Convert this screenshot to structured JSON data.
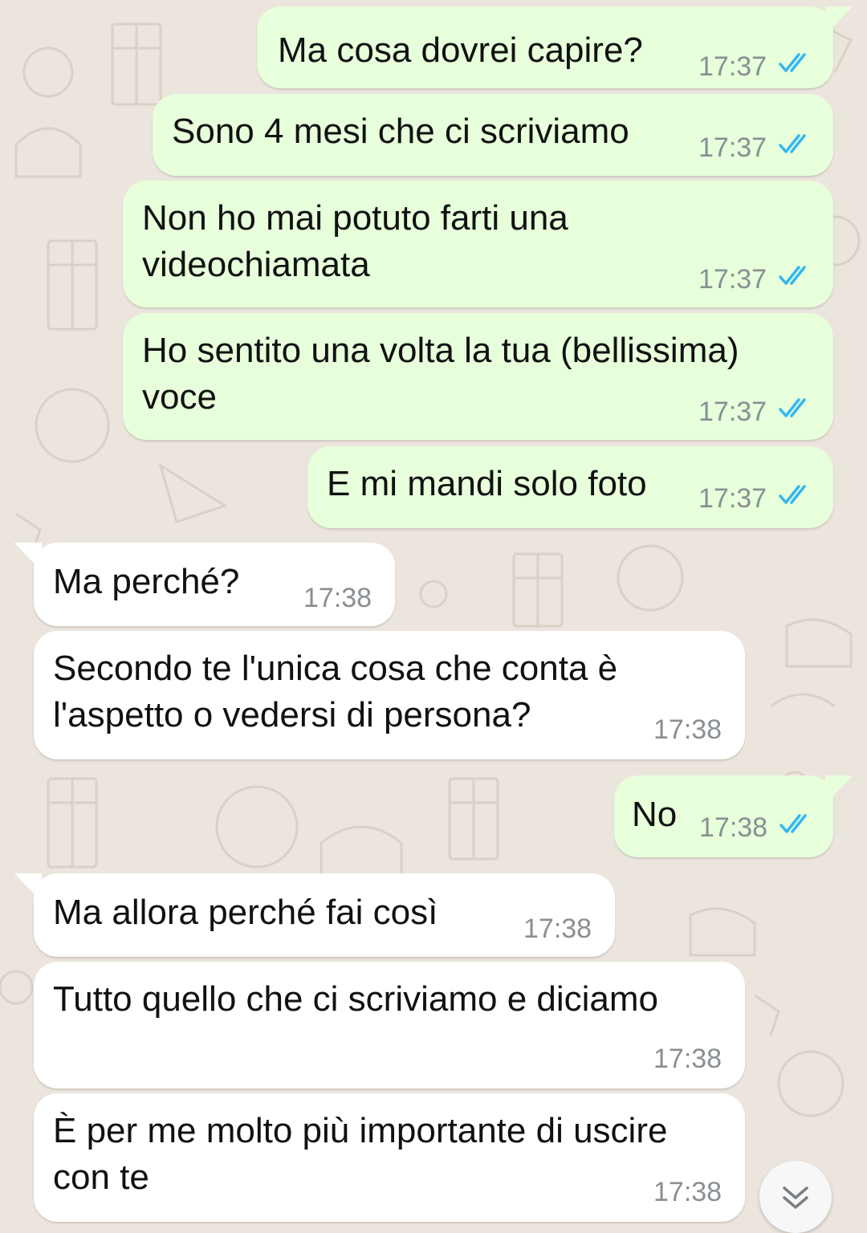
{
  "colors": {
    "outgoing_bubble": "#e7ffdb",
    "incoming_bubble": "#ffffff",
    "wallpaper": "#ece5dd",
    "read_ticks": "#34b7f1",
    "timestamp": "#8a8f93"
  },
  "messages": [
    {
      "direction": "out",
      "lines": [
        "Ma cosa dovrei capire?"
      ],
      "time": "17:37",
      "status": "read"
    },
    {
      "direction": "out",
      "lines": [
        "Sono 4 mesi che ci scriviamo"
      ],
      "time": "17:37",
      "status": "read"
    },
    {
      "direction": "out",
      "lines": [
        "Non ho mai potuto farti una",
        "videochiamata"
      ],
      "time": "17:37",
      "status": "read"
    },
    {
      "direction": "out",
      "lines": [
        "Ho sentito una volta la tua (bellissima)",
        "voce"
      ],
      "time": "17:37",
      "status": "read"
    },
    {
      "direction": "out",
      "lines": [
        "E mi mandi solo foto"
      ],
      "time": "17:37",
      "status": "read"
    },
    {
      "direction": "in",
      "lines": [
        "Ma perché?"
      ],
      "time": "17:38"
    },
    {
      "direction": "in",
      "lines": [
        "Secondo te l'unica cosa che conta è",
        "l'aspetto o vedersi di persona?"
      ],
      "time": "17:38"
    },
    {
      "direction": "out",
      "lines": [
        "No"
      ],
      "time": "17:38",
      "status": "read"
    },
    {
      "direction": "in",
      "lines": [
        "Ma allora perché fai così"
      ],
      "time": "17:38"
    },
    {
      "direction": "in",
      "lines": [
        "Tutto quello che ci scriviamo e diciamo"
      ],
      "time": "17:38"
    },
    {
      "direction": "in",
      "lines": [
        "È per me molto più importante di uscire",
        "con te"
      ],
      "time": "17:38"
    }
  ],
  "icons": {
    "read_receipt": "double-check-icon",
    "scroll_down": "chevron-double-down-icon"
  }
}
